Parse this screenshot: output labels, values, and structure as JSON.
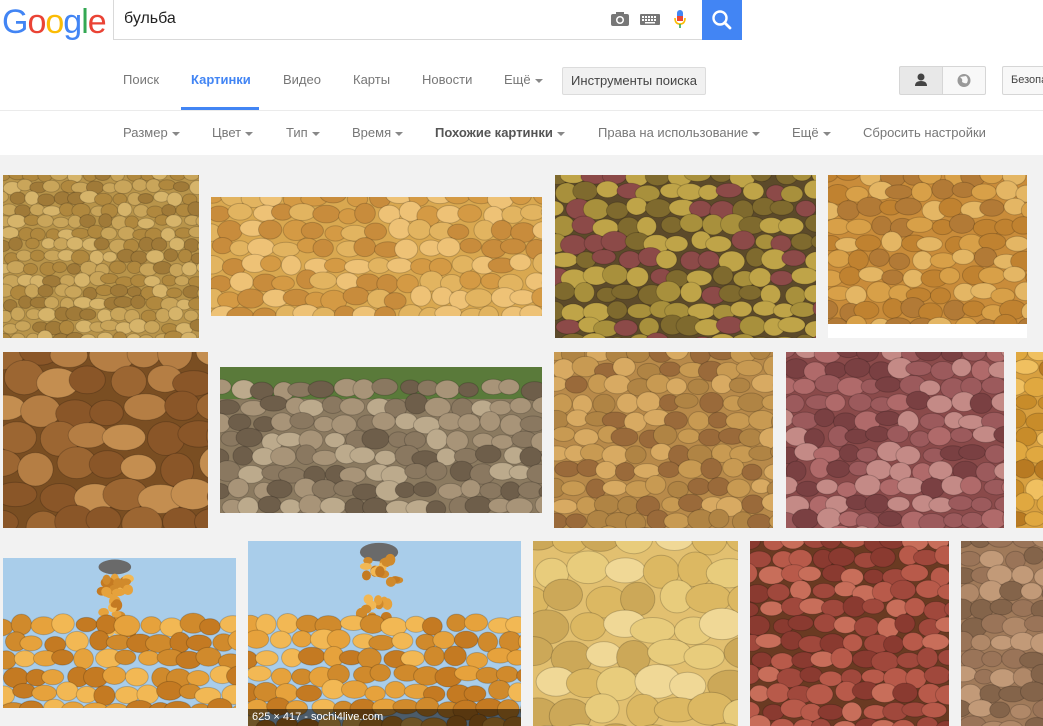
{
  "logo": {
    "letters": [
      "G",
      "o",
      "o",
      "g",
      "l",
      "e"
    ],
    "colors": [
      "#4285f4",
      "#ea4335",
      "#fbbc05",
      "#4285f4",
      "#34a853",
      "#ea4335"
    ]
  },
  "search": {
    "value": "бульба",
    "placeholder": ""
  },
  "nav": {
    "tabs": [
      {
        "label": "Поиск",
        "active": false
      },
      {
        "label": "Картинки",
        "active": true
      },
      {
        "label": "Видео",
        "active": false
      },
      {
        "label": "Карты",
        "active": false
      },
      {
        "label": "Новости",
        "active": false
      },
      {
        "label": "Ещё",
        "active": false
      }
    ],
    "tools_label": "Инструменты поиска",
    "safe_label": "Безопасный поиск"
  },
  "filters": [
    {
      "label": "Размер",
      "caret": true,
      "bold": false
    },
    {
      "label": "Цвет",
      "caret": true,
      "bold": false
    },
    {
      "label": "Тип",
      "caret": true,
      "bold": false
    },
    {
      "label": "Время",
      "caret": true,
      "bold": false
    },
    {
      "label": "Похожие картинки",
      "caret": true,
      "bold": true
    },
    {
      "label": "Права на использование",
      "caret": true,
      "bold": false
    },
    {
      "label": "Ещё",
      "caret": true,
      "bold": false
    },
    {
      "label": "Сбросить настройки",
      "caret": false,
      "bold": false
    }
  ],
  "images": [
    {
      "kind": "small-dense",
      "bg": "#b8944a"
    },
    {
      "kind": "oval-light",
      "bg": "#d9a850"
    },
    {
      "kind": "pile-mixed",
      "bg": "#5c4a2a"
    },
    {
      "kind": "stamp",
      "bg": "#c98c3a"
    },
    {
      "kind": "big-brown",
      "bg": "#7a4e22"
    },
    {
      "kind": "field-pile",
      "bg": "#8b7a60"
    },
    {
      "kind": "sacks",
      "bg": "#b88a4a"
    },
    {
      "kind": "red",
      "bg": "#8a4a4a"
    },
    {
      "kind": "edge",
      "bg": "#d8a040"
    },
    {
      "kind": "pour",
      "bg": "#9ec6e8"
    },
    {
      "kind": "pour",
      "bg": "#9ec6e8",
      "caption": "625 × 417 - sochi4live.com"
    },
    {
      "kind": "yellow-big",
      "bg": "#e2c070"
    },
    {
      "kind": "baskets",
      "bg": "#6a3a22"
    },
    {
      "kind": "edge2",
      "bg": "#a07a5a"
    }
  ]
}
